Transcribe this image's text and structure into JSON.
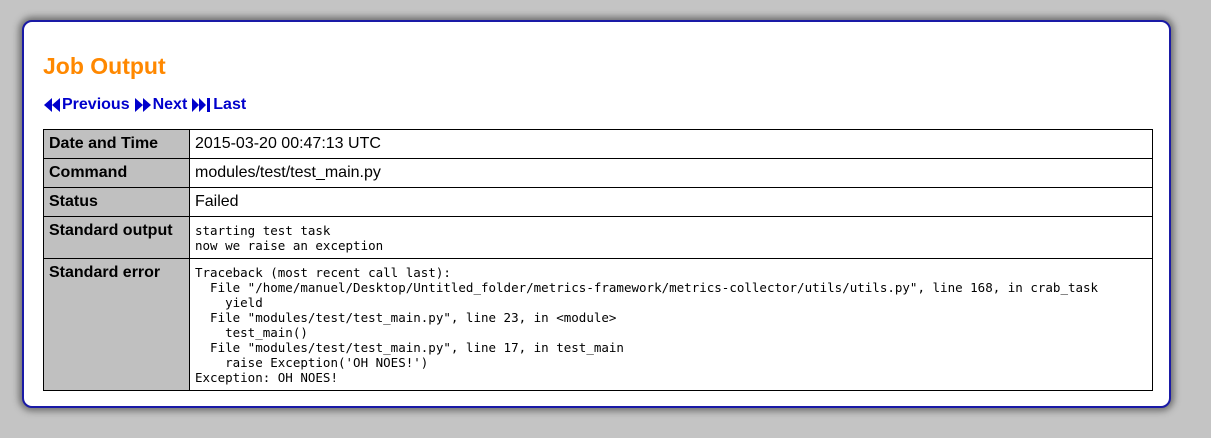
{
  "page": {
    "title": "Job Output"
  },
  "nav": {
    "previous_label": "Previous",
    "next_label": "Next",
    "last_label": "Last"
  },
  "details": {
    "rows": [
      {
        "label": "Date and Time",
        "value": "2015-03-20 00:47:13 UTC"
      },
      {
        "label": "Command",
        "value": "modules/test/test_main.py"
      },
      {
        "label": "Status",
        "value": "Failed"
      },
      {
        "label": "Standard output",
        "value": "starting test task\nnow we raise an exception"
      },
      {
        "label": "Standard error",
        "value": "Traceback (most recent call last):\n  File \"/home/manuel/Desktop/Untitled_folder/metrics-framework/metrics-collector/utils/utils.py\", line 168, in crab_task\n    yield\n  File \"modules/test/test_main.py\", line 23, in <module>\n    test_main()\n  File \"modules/test/test_main.py\", line 17, in test_main\n    raise Exception('OH NOES!')\nException: OH NOES!"
      }
    ]
  },
  "colors": {
    "title": "#ff8800",
    "link": "#0000cc",
    "panel_border": "#1a1aa6",
    "header_cell_bg": "#c0c0c0",
    "page_bg": "#c4c4c4"
  },
  "icons": {
    "previous": "double-left-arrow-icon",
    "next": "double-right-arrow-icon",
    "last": "skip-to-end-icon"
  }
}
